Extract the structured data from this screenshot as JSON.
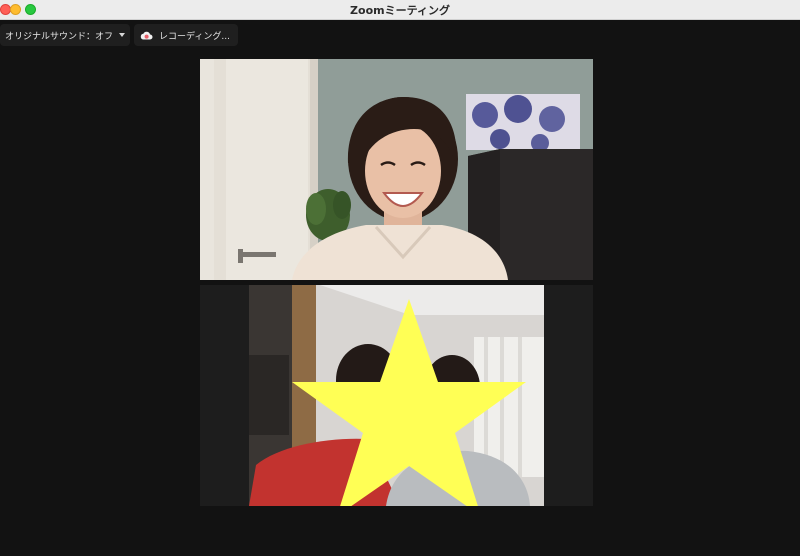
{
  "window": {
    "title": "Zoomミーティング"
  },
  "toolbar": {
    "audio_label": "オリジナルサウンド：オフ",
    "recording_label": "レコーディング..."
  },
  "video": {
    "participant_1_icon": "person-video-feed",
    "participant_2_icon": "star-overlay-covered-video"
  },
  "colors": {
    "background": "#121212",
    "star": "#ffff55",
    "record_icon": "#e8616b"
  }
}
